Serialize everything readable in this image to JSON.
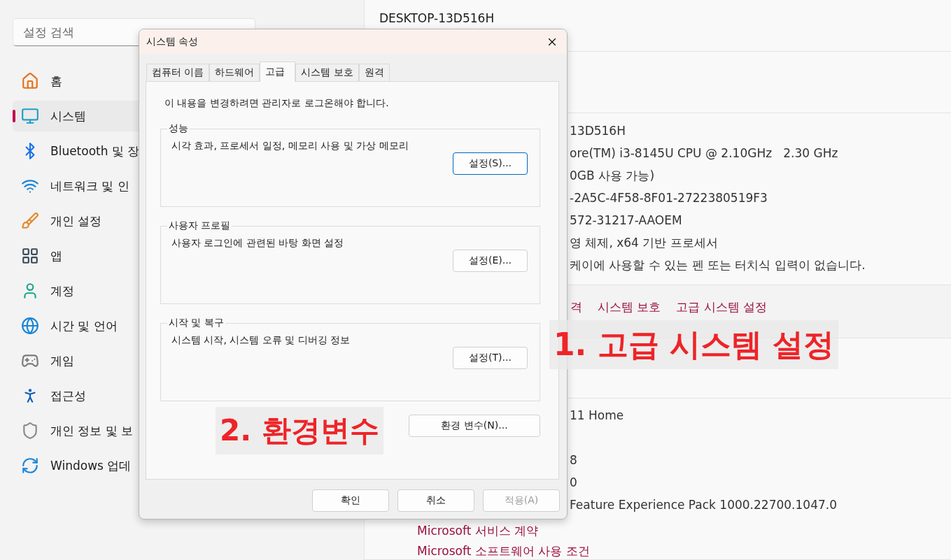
{
  "settings": {
    "search": {
      "placeholder": "설정 검색"
    },
    "nav": [
      {
        "label": "홈",
        "selected": false
      },
      {
        "label": "시스템",
        "selected": true
      },
      {
        "label": "Bluetooth 및 장",
        "selected": false
      },
      {
        "label": "네트워크 및 인",
        "selected": false
      },
      {
        "label": "개인 설정",
        "selected": false
      },
      {
        "label": "앱",
        "selected": false
      },
      {
        "label": "계정",
        "selected": false
      },
      {
        "label": "시간 및 언어",
        "selected": false
      },
      {
        "label": "게임",
        "selected": false
      },
      {
        "label": "접근성",
        "selected": false
      },
      {
        "label": "개인 정보 및 보",
        "selected": false
      },
      {
        "label": "Windows 업데",
        "selected": false
      }
    ]
  },
  "device": {
    "name": "DESKTOP-13D516H"
  },
  "device_specs": [
    "13D516H",
    "ore(TM) i3-8145U CPU @ 2.10GHz   2.30 GHz",
    "0GB 사용 가능)",
    "-2A5C-4F58-8F01-2722380519F3",
    "572-31217-AAOEM",
    "영 체제, x64 기반 프로세서",
    "케이에 사용할 수 있는 펜 또는 터치식 입력이 없습니다."
  ],
  "related_links": [
    "격",
    "시스템 보호",
    "고급 시스템 설정"
  ],
  "windows_specs": [
    "11 Home",
    "8",
    "0",
    "Feature Experience Pack 1000.22700.1047.0"
  ],
  "support_links": [
    "Microsoft 서비스 계약",
    "Microsoft 소프트웨어 사용 조건"
  ],
  "dialog": {
    "title": "시스템 속성",
    "tabs": [
      {
        "label": "컴퓨터 이름",
        "selected": false
      },
      {
        "label": "하드웨어",
        "selected": false
      },
      {
        "label": "고급",
        "selected": true
      },
      {
        "label": "시스템 보호",
        "selected": false
      },
      {
        "label": "원격",
        "selected": false
      }
    ],
    "notice": "이 내용을 변경하려면 관리자로 로그온해야 합니다.",
    "groups": [
      {
        "title": "성능",
        "description": "시각 효과, 프로세서 일정, 메모리 사용 및 가상 메모리",
        "button": "설정(S)...",
        "focused": true
      },
      {
        "title": "사용자 프로필",
        "description": "사용자 로그인에 관련된 바탕 화면 설정",
        "button": "설정(E)...",
        "focused": false
      },
      {
        "title": "시작 및 복구",
        "description": "시스템 시작, 시스템 오류 및 디버깅 정보",
        "button": "설정(T)...",
        "focused": false
      }
    ],
    "env_button": "환경 변수(N)...",
    "buttons": [
      {
        "label": "확인",
        "disabled": false
      },
      {
        "label": "취소",
        "disabled": false
      },
      {
        "label": "적용(A)",
        "disabled": true
      }
    ]
  },
  "annotations": [
    {
      "text": "1. 고급 시스템 설정"
    },
    {
      "text": "2. 환경변수"
    }
  ]
}
